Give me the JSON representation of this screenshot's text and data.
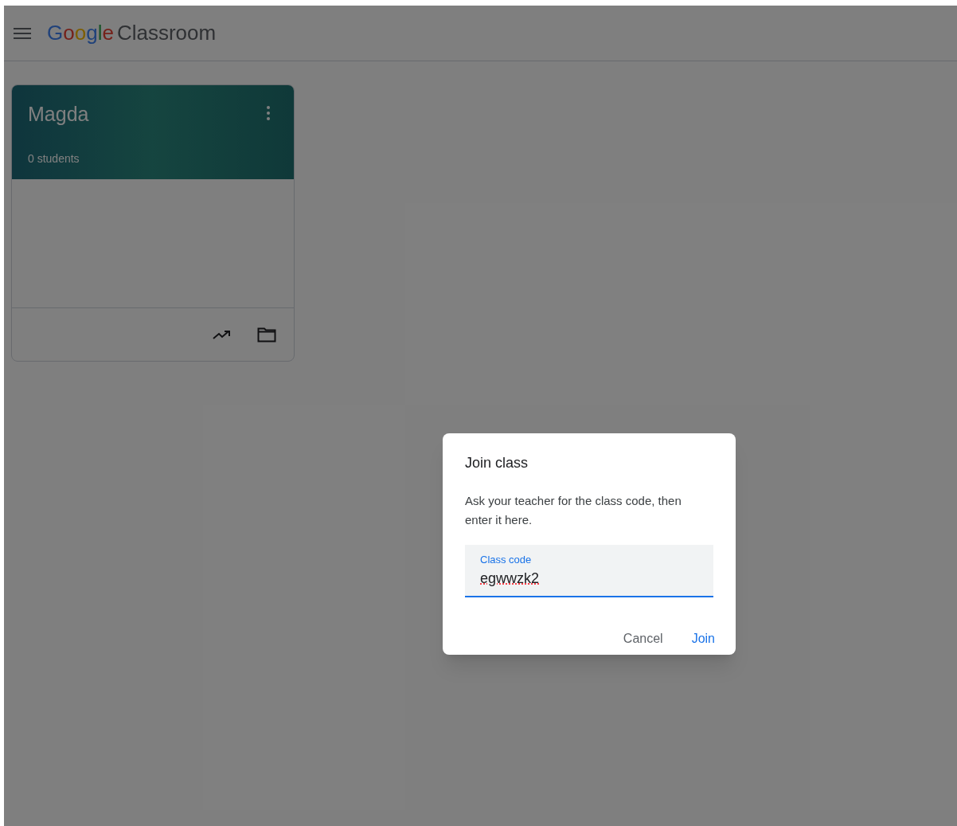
{
  "header": {
    "logo_brand": "Google",
    "logo_product": "Classroom"
  },
  "classes": [
    {
      "name": "Magda",
      "students": "0 students"
    }
  ],
  "dialog": {
    "title": "Join class",
    "message": "Ask your teacher for the class code, then enter it here.",
    "field": {
      "label": "Class code",
      "value": "egwwzk2"
    },
    "buttons": [
      {
        "label": "Cancel",
        "kind": "secondary"
      },
      {
        "label": "Join",
        "kind": "primary"
      }
    ]
  }
}
